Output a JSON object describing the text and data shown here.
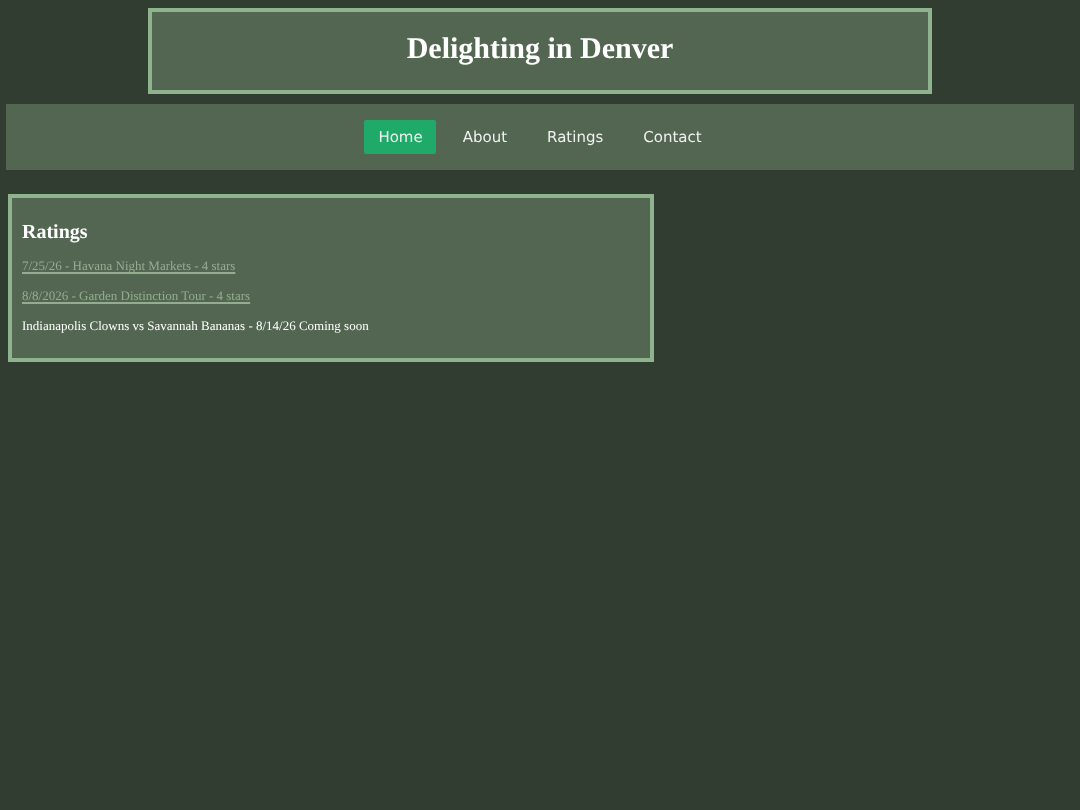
{
  "header": {
    "title": "Delighting in Denver"
  },
  "nav": [
    {
      "label": "Home",
      "selected": true
    },
    {
      "label": "About",
      "selected": false
    },
    {
      "label": "Ratings",
      "selected": false
    },
    {
      "label": "Contact",
      "selected": false
    }
  ],
  "ratings": {
    "title": "Ratings",
    "entries": [
      {
        "kind": "link",
        "text": "7/25/26 - Havana Night Markets - 4 stars"
      },
      {
        "kind": "link",
        "text": "8/8/2026 - Garden Distinction Tour - 4 stars"
      },
      {
        "kind": "text",
        "text": "Indianapolis Clowns vs Savannah Bananas - 8/14/26 Coming soon"
      }
    ]
  }
}
